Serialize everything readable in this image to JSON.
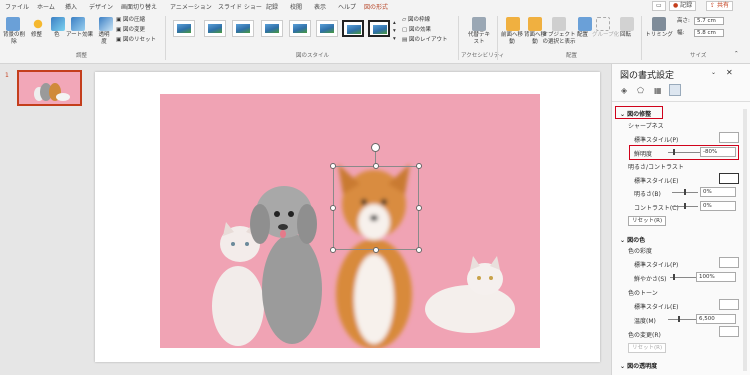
{
  "tabs": [
    "ファイル",
    "ホーム",
    "挿入",
    "デザイン",
    "画面切り替え",
    "アニメーション",
    "スライド ショー",
    "記録",
    "校閲",
    "表示",
    "ヘルプ",
    "図の形式"
  ],
  "top_buttons": {
    "record": "記録",
    "share": "共有"
  },
  "ribbon": {
    "adjust": {
      "remove_bg": "背景の削除",
      "corrections": "修整",
      "color": "色",
      "artistic": "アート効果",
      "transparency": "透明度",
      "compress": "図の圧縮",
      "change": "図の変更",
      "reset": "図のリセット",
      "group": "調整"
    },
    "styles": {
      "group": "図のスタイル",
      "border": "図の枠線",
      "effects": "図の効果",
      "layout": "図のレイアウト"
    },
    "access": {
      "alt_text": "代替テキスト",
      "group": "アクセシビリティ"
    },
    "arrange": {
      "forward": "前面へ移動",
      "backward": "背面へ移動",
      "selection": "オブジェクトの選択と表示",
      "align": "配置",
      "group_btn": "グループ化",
      "rotate": "回転",
      "group": "配置"
    },
    "size": {
      "crop": "トリミング",
      "height_label": "高さ:",
      "height": "5.7 cm",
      "width_label": "幅:",
      "width": "5.8 cm",
      "group": "サイズ"
    }
  },
  "slide_number": "1",
  "panel": {
    "title": "図の書式設定",
    "section_corrections": "図の修整",
    "sharpness_label": "シャープネス",
    "preset_label": "標準スタイル(P)",
    "sharpness_sub_label": "鮮明度",
    "sharpness_value": "-80%",
    "brightness_contrast_label": "明るさ/コントラスト",
    "preset2_label": "標準スタイル(E)",
    "brightness_label": "明るさ(B)",
    "brightness_value": "0%",
    "contrast_label": "コントラスト(C)",
    "contrast_value": "0%",
    "reset_label": "リセット(R)",
    "section_color": "図の色",
    "saturation_label": "色の彩度",
    "preset3_label": "標準スタイル(P)",
    "saturation_sub_label": "鮮やかさ(S)",
    "saturation_value": "100%",
    "tone_label": "色のトーン",
    "preset4_label": "標準スタイル(E)",
    "temperature_label": "温度(M)",
    "temperature_value": "6,500",
    "recolor_label": "色の変更(R)",
    "reset2_label": "リセット(R)",
    "section_transparency": "図の透明度"
  },
  "colors": {
    "accent": "#b7472a",
    "highlight": "#d0021b",
    "slide_bg": "#f0a3b4"
  }
}
